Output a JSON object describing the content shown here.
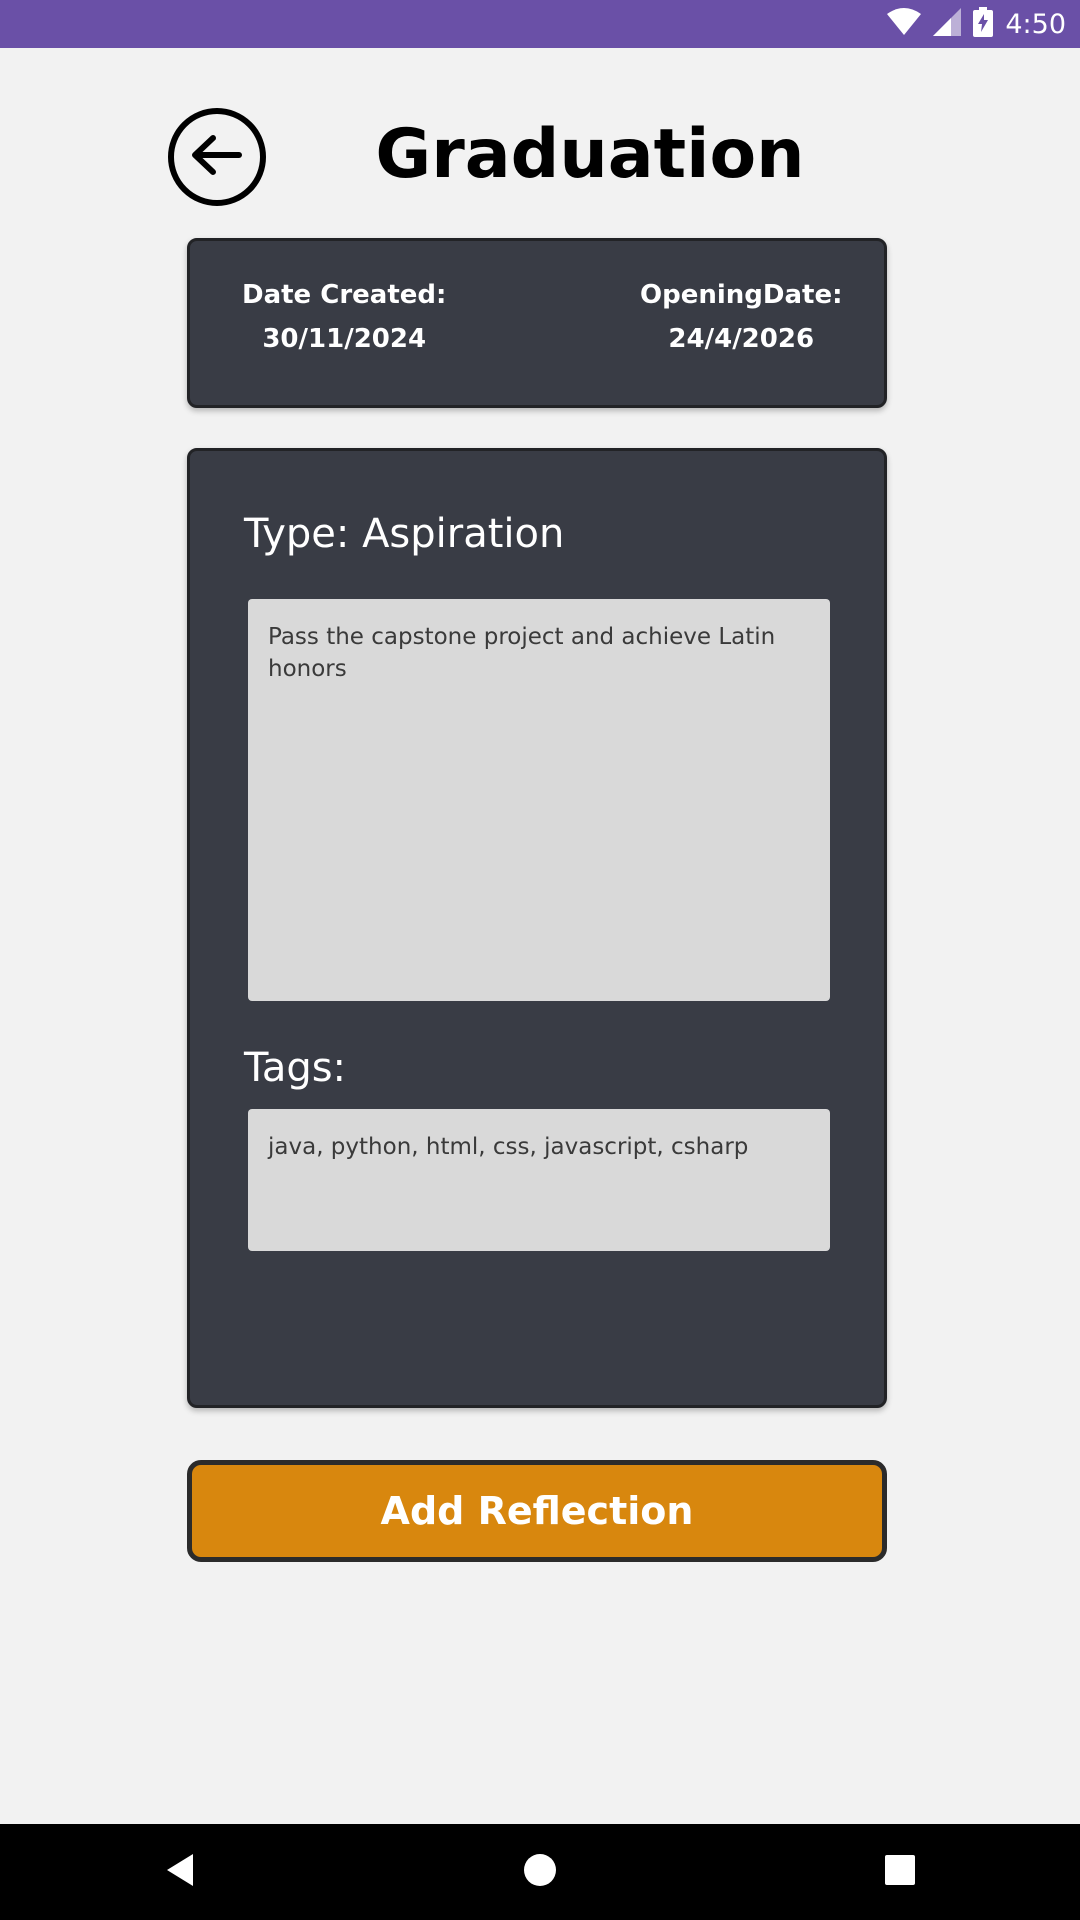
{
  "status_bar": {
    "time": "4:50",
    "icons": [
      "wifi-icon",
      "cell-signal-icon",
      "battery-charging-icon"
    ],
    "background": "#6a50a7"
  },
  "header": {
    "title": "Graduation",
    "back_icon": "arrow-left-circle-icon"
  },
  "dates": {
    "created_label": "Date Created:",
    "created_value": "30/11/2024",
    "opening_label": "OpeningDate:",
    "opening_value": "24/4/2026"
  },
  "entry": {
    "type_label": "Type: Aspiration",
    "content": "Pass the capstone project and achieve Latin honors",
    "tags_label": "Tags:",
    "tags_value": "java, python, html, css, javascript, csharp"
  },
  "actions": {
    "add_reflection_label": "Add Reflection"
  },
  "nav_bar": {
    "icons": [
      "back-triangle-icon",
      "home-circle-icon",
      "recents-square-icon"
    ]
  },
  "colors": {
    "card": "#393c45",
    "field": "#d9d9d9",
    "accent": "#d8870e",
    "page_background": "#f2f2f2"
  }
}
